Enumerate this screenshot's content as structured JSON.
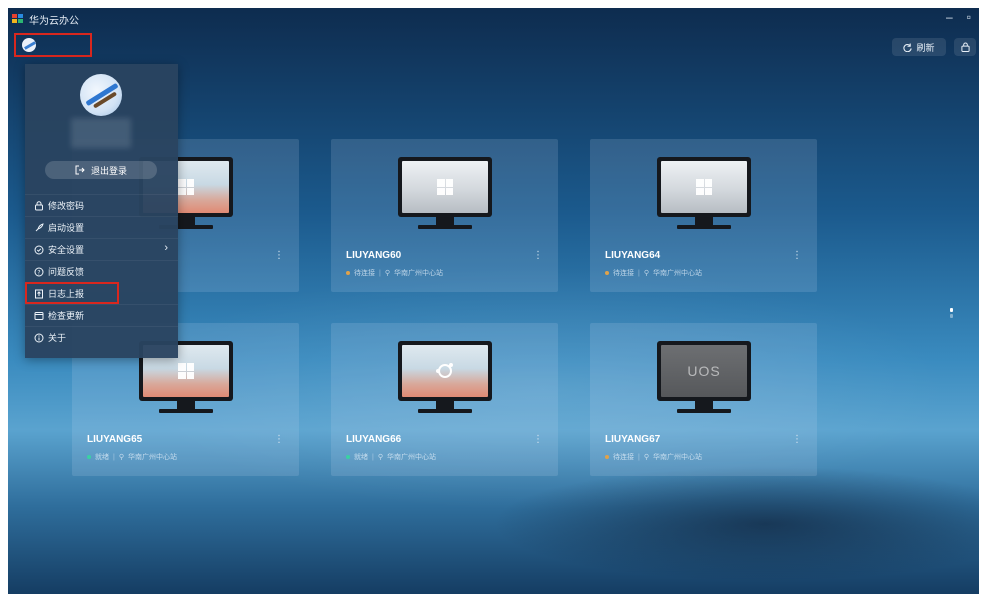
{
  "window": {
    "title": "华为云办公",
    "minimize_glyph": "–",
    "maximize_glyph": "▫"
  },
  "toolbar": {
    "refresh_label": "刷新",
    "refresh_icon": "refresh-icon",
    "lock_icon": "lock-icon"
  },
  "account_menu": {
    "logout_label": "退出登录",
    "items": [
      {
        "label": "修改密码",
        "icon": "lock-icon"
      },
      {
        "label": "启动设置",
        "icon": "rocket-icon"
      },
      {
        "label": "安全设置",
        "icon": "shield-icon",
        "has_submenu": true
      },
      {
        "label": "问题反馈",
        "icon": "question-icon"
      },
      {
        "label": "日志上报",
        "icon": "upload-icon",
        "highlighted": true
      },
      {
        "label": "检查更新",
        "icon": "update-icon"
      },
      {
        "label": "关于",
        "icon": "info-icon"
      }
    ]
  },
  "desktops": [
    {
      "name": "",
      "status": "",
      "region": "",
      "screen": "win"
    },
    {
      "name": "LIUYANG60",
      "status": "待连接",
      "region": "华南广州中心站",
      "status_color": "#e0a24a",
      "screen": "win"
    },
    {
      "name": "LIUYANG64",
      "status": "待连接",
      "region": "华南广州中心站",
      "status_color": "#e0a24a",
      "screen": "win"
    },
    {
      "name": "LIUYANG65",
      "status": "就绪",
      "region": "华南广州中心站",
      "status_color": "#39d2a2",
      "screen": "win"
    },
    {
      "name": "LIUYANG66",
      "status": "就绪",
      "region": "华南广州中心站",
      "status_color": "#39d2a2",
      "screen": "ubuntu"
    },
    {
      "name": "LIUYANG67",
      "status": "待连接",
      "region": "华南广州中心站",
      "status_color": "#e0a24a",
      "screen": "uos",
      "screen_text": "UOS"
    }
  ],
  "colors": {
    "highlight_box": "#d9271e",
    "menu_bg": "#2a4460"
  }
}
